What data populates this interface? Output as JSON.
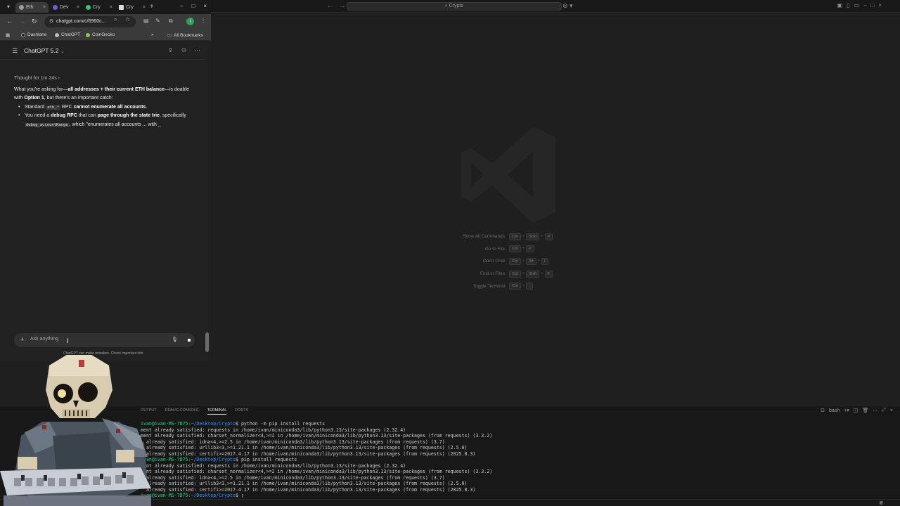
{
  "browser": {
    "tabs": [
      {
        "label": "Eth",
        "color": "#9a9a9a",
        "active": true
      },
      {
        "label": "Dev",
        "color": "#6c5ce7",
        "active": false
      },
      {
        "label": "Cry",
        "color": "#2ecc71",
        "active": false
      },
      {
        "label": "Cry",
        "color": "#dddddd",
        "active": false
      }
    ],
    "url": "chatgpt.com/c/6960c...",
    "bookmarks": [
      "Dashlane",
      "ChatGPT",
      "CoinGecko"
    ],
    "all_bookmarks": "All Bookmarks",
    "profile_initial": "I"
  },
  "chatgpt": {
    "model": "ChatGPT 5.2",
    "thought": "Thought for 1m 24s",
    "intro": {
      "p1": "What you're asking for—",
      "b1": "all addresses + their current ETH balance",
      "p2": "—is doable with ",
      "b2": "Option 1",
      "p3": ", but there's an important catch:"
    },
    "bullets": {
      "b1_pre": "Standard ",
      "b1_code": "eth_*",
      "b1_mid": " RPC ",
      "b1_bold": "cannot enumerate all accounts",
      "b1_end": ".",
      "b2_pre": "You need a ",
      "b2_bold1": "debug RPC",
      "b2_mid": " that can ",
      "b2_bold2": "page through the state trie",
      "b2_mid2": ", specifically ",
      "b2_code": "debug_accountRange",
      "b2_end": ", which \"enumerates all accounts ... with _"
    },
    "composer_placeholder": "Ask anything",
    "disclaimer": "ChatGPT can make mistakes. Check important info."
  },
  "vscode": {
    "search": "Crypto",
    "shortcuts": [
      {
        "label": "Show All Commands",
        "keys": [
          "Ctrl",
          "Shift",
          "P"
        ]
      },
      {
        "label": "Go to File",
        "keys": [
          "Ctrl",
          "P"
        ]
      },
      {
        "label": "Open Chat",
        "keys": [
          "Ctrl",
          "Alt",
          "I"
        ]
      },
      {
        "label": "Find in Files",
        "keys": [
          "Ctrl",
          "Shift",
          "F"
        ]
      },
      {
        "label": "Toggle Terminal",
        "keys": [
          "Ctrl",
          "`"
        ]
      }
    ],
    "panel_tabs": [
      "OUTPUT",
      "DEBUG CONSOLE",
      "TERMINAL",
      "PORTS"
    ],
    "terminal_shell": "bash",
    "terminal": {
      "prompt_user": "ivan@ivan-MS-7D75",
      "prompt_path": ":~/Desktop/Crypto",
      "cmd1": "$ python -m pip install requests",
      "cmd2": "$ pip install requests",
      "lines1": [
        "ment already satisfied: requests in /home/ivan/miniconda3/lib/python3.13/site-packages (2.32.4)",
        "ment already satisfied: charset_normalizer<4,>=2 in /home/ivan/miniconda3/lib/python3.13/site-packages (from requests) (3.3.2)",
        "  already satisfied: idna<4,>=2.5 in /home/ivan/miniconda3/lib/python3.13/site-packages (from requests) (3.7)",
        "  already satisfied: urllib3<3,>=1.21.1 in /home/ivan/miniconda3/lib/python3.13/site-packages (from requests) (2.5.0)",
        "  already satisfied: certifi>=2017.4.17 in /home/ivan/miniconda3/lib/python3.13/site-packages (from requests) (2025.8.3)"
      ],
      "lines2": [
        "ment already satisfied: requests in /home/ivan/miniconda3/lib/python3.13/site-packages (2.32.4)",
        "ment already satisfied: charset_normalizer<4,>=2 in /home/ivan/miniconda3/lib/python3.13/site-packages (from requests) (3.3.2)",
        "  already satisfied: idna<4,>=2.5 in /home/ivan/miniconda3/lib/python3.13/site-packages (from requests) (3.7)",
        "  already satisfied: urllib3<3,>=1.21.1 in /home/ivan/miniconda3/lib/python3.13/site-packages (from requests) (2.5.0)",
        "  already satisfied: certifi>=2017.4.17 in /home/ivan/miniconda3/lib/python3.13/site-packages (from requests) (2025.8.3)"
      ],
      "final_prompt": "$ "
    }
  },
  "colors": {
    "vscode_bg": "#1f1f1f",
    "chrome_toolbar": "#3a3a3a",
    "chatgpt_bg": "#212121",
    "terminal_user": "#23d18b",
    "terminal_path": "#3b8eea"
  }
}
